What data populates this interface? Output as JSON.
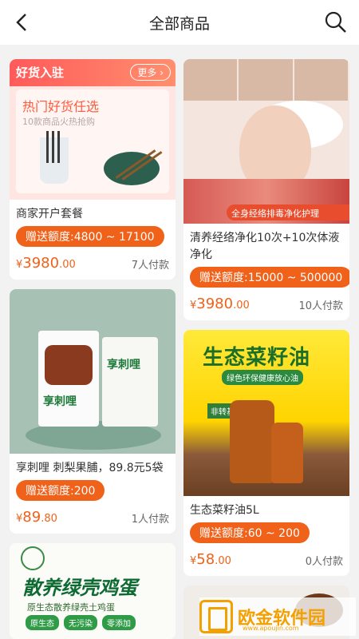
{
  "header": {
    "title": "全部商品"
  },
  "products": [
    {
      "name": "商家开户套餐",
      "quota": "赠送额度:4800 ~ 17100",
      "price_symbol": "¥",
      "price_int": "3980",
      "price_dec": ".00",
      "paid": "7人付款",
      "promo": {
        "badge": "好货入驻",
        "more": "更多",
        "headline": "热门好货任选",
        "sub": "10款商品火热抢购"
      }
    },
    {
      "name": "清养经络净化10次+10次体液净化",
      "quota": "赠送额度:15000 ~ 500000",
      "price_symbol": "¥",
      "price_int": "3980",
      "price_dec": ".00",
      "paid": "10人付款",
      "image_text": "全身经络排毒净化护理"
    },
    {
      "name": "享刺哩 刺梨果脯，89.8元5袋",
      "quota": "赠送额度:200",
      "price_symbol": "¥",
      "price_int": "89",
      "price_dec": ".80",
      "paid": "1人付款",
      "image_text": "享刺哩"
    },
    {
      "name": "生态菜籽油5L",
      "quota": "赠送额度:60 ~ 200",
      "price_symbol": "¥",
      "price_int": "58",
      "price_dec": ".00",
      "paid": "0人付款",
      "image_title": "生态菜籽油",
      "image_sub": "绿色环保健康放心油",
      "image_tag": "非转基因"
    },
    {
      "image_title": "散养绿壳鸡蛋",
      "image_sub": "原生态散养绿壳土鸡蛋",
      "chips": [
        "原生态",
        "无污染",
        "零添加"
      ]
    },
    {}
  ],
  "watermark": {
    "text": "欧金软件园",
    "url": "www.apoujin.com"
  },
  "colors": {
    "accent": "#f0611a",
    "header_bg": "#ffffff",
    "page_bg": "#f2f2f2"
  },
  "icons": {
    "back": "chevron-left-icon",
    "search": "search-icon"
  }
}
